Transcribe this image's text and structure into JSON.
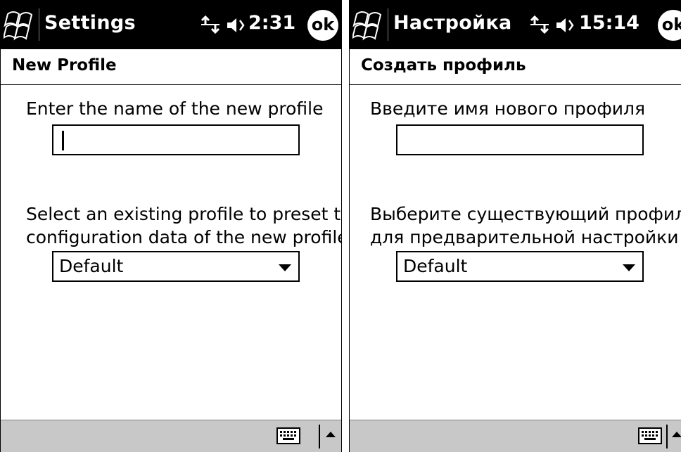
{
  "screens": [
    {
      "title": "Settings",
      "clock": "2:31",
      "ok_label": "ok",
      "header": "New Profile",
      "name_prompt": "Enter the name of the new profile",
      "name_value": "",
      "preset_prompt_line1": "Select an existing profile to preset the",
      "preset_prompt_line2": "configuration data of the new profile",
      "preset_selected": "Default"
    },
    {
      "title": "Настройка",
      "clock": "15:14",
      "ok_label": "ok",
      "header": "Создать профиль",
      "name_prompt": "Введите имя нового профиля",
      "name_value": "",
      "preset_prompt_line1": "Выберите существующий профиль",
      "preset_prompt_line2": "для предварительной настройки",
      "preset_selected": "Default"
    }
  ],
  "icons": {
    "start": "windows-flag-icon",
    "connectivity": "connectivity-arrows-icon",
    "volume": "speaker-icon",
    "keyboard": "keyboard-icon",
    "sip_menu": "sip-arrow-up-icon"
  },
  "colors": {
    "titlebar": "#000000",
    "background": "#ffffff",
    "menubar": "#c8c8c8"
  }
}
